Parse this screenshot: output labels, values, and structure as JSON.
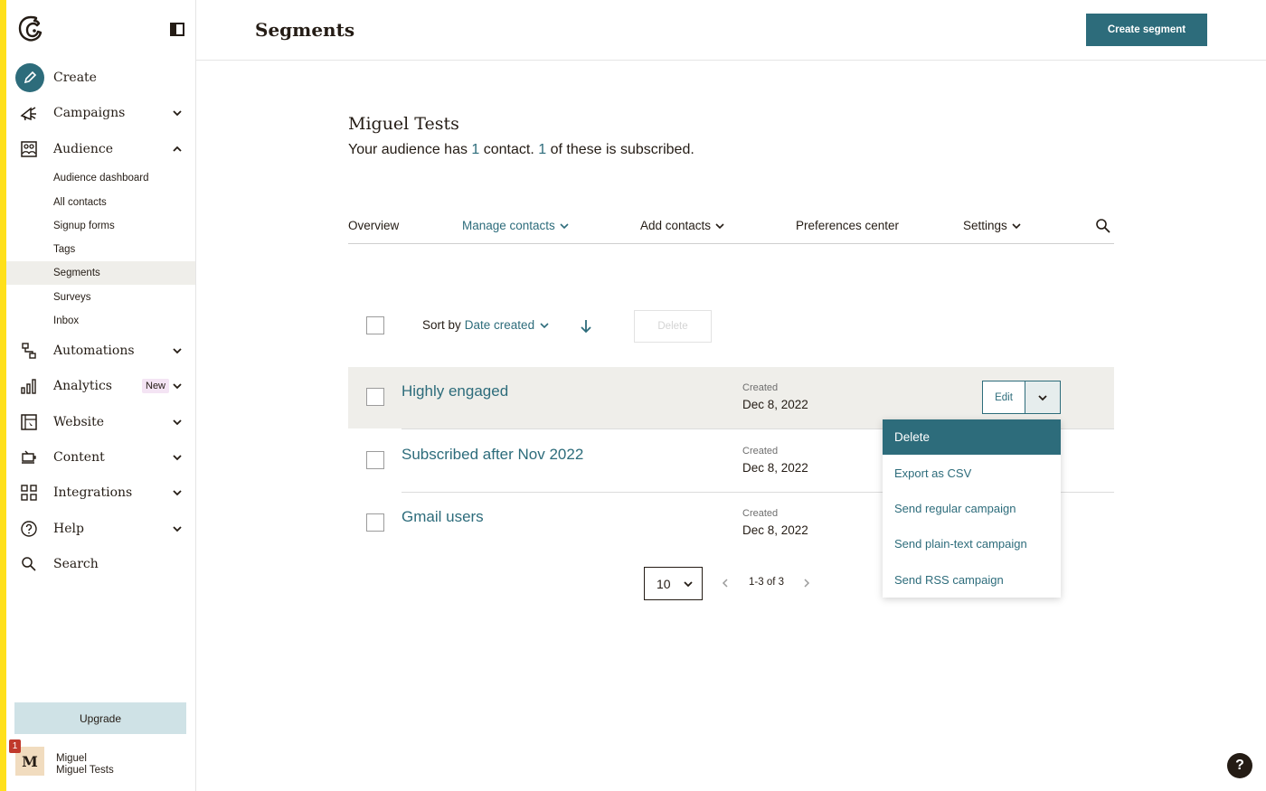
{
  "sidebar": {
    "nav": {
      "create": "Create",
      "campaigns": "Campaigns",
      "audience": "Audience",
      "automations": "Automations",
      "analytics": "Analytics",
      "analytics_badge": "New",
      "website": "Website",
      "content": "Content",
      "integrations": "Integrations",
      "help": "Help",
      "search": "Search"
    },
    "audience_sub": {
      "dashboard": "Audience dashboard",
      "all_contacts": "All contacts",
      "signup_forms": "Signup forms",
      "tags": "Tags",
      "segments": "Segments",
      "surveys": "Surveys",
      "inbox": "Inbox"
    },
    "upgrade_label": "Upgrade",
    "account": {
      "avatar_initial": "M",
      "notification_count": "1",
      "name": "Miguel",
      "org": "Miguel Tests"
    }
  },
  "header": {
    "title": "Segments",
    "create_button": "Create segment"
  },
  "audience": {
    "name": "Miguel Tests",
    "summary_prefix": "Your audience has ",
    "contact_count": "1",
    "summary_mid": " contact. ",
    "subscribed_count": "1",
    "summary_suffix": " of these is subscribed."
  },
  "tabs": {
    "overview": "Overview",
    "manage_contacts": "Manage contacts",
    "add_contacts": "Add contacts",
    "preferences_center": "Preferences center",
    "settings": "Settings"
  },
  "toolbar": {
    "sort_prefix": "Sort by",
    "sort_value": "Date created",
    "delete_label": "Delete"
  },
  "segments": [
    {
      "name": "Highly engaged",
      "created_label": "Created",
      "created_date": "Dec 8, 2022"
    },
    {
      "name": "Subscribed after Nov 2022",
      "created_label": "Created",
      "created_date": "Dec 8, 2022"
    },
    {
      "name": "Gmail users",
      "created_label": "Created",
      "created_date": "Dec 8, 2022"
    }
  ],
  "row_actions": {
    "edit_label": "Edit",
    "menu": {
      "delete": "Delete",
      "export_csv": "Export as CSV",
      "send_regular": "Send regular campaign",
      "send_plain": "Send plain-text campaign",
      "send_rss": "Send RSS campaign"
    }
  },
  "pagination": {
    "per_page": "10",
    "range": "1-3 of 3"
  },
  "colors": {
    "accent": "#2d6c7b",
    "brand_yellow": "#ffe01b",
    "highlight_row": "#efeeea"
  },
  "help_fab": "?"
}
